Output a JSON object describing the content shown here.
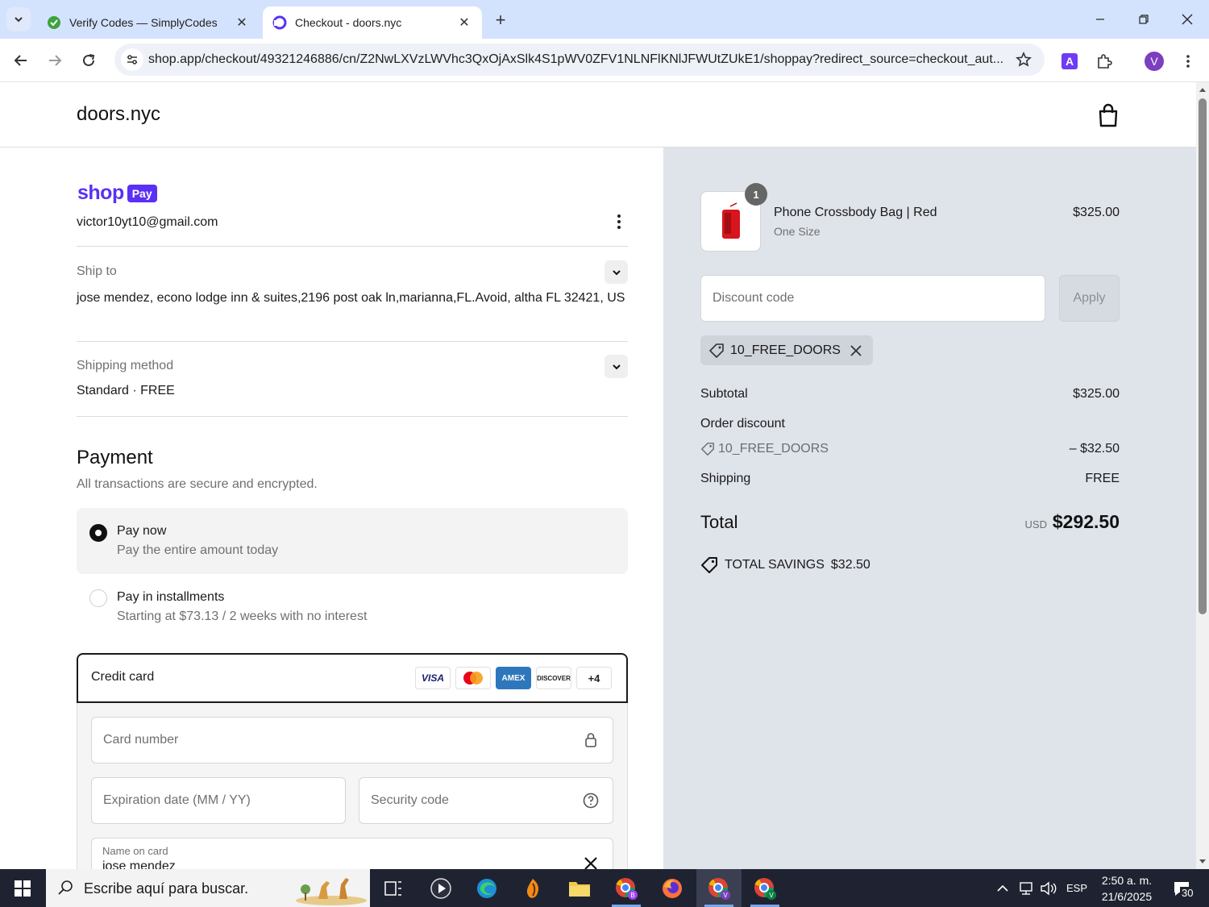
{
  "browser": {
    "tabs": [
      {
        "title": "Verify Codes — SimplyCodes",
        "active": false
      },
      {
        "title": "Checkout - doors.nyc",
        "active": true
      }
    ],
    "url": "shop.app/checkout/49321246886/cn/Z2NwLXVzLWVhc3QxOjAxSlk4S1pWV0ZFV1NLNFlKNlJFWUtZUkE1/shoppay?redirect_source=checkout_aut...",
    "profile_initial": "V"
  },
  "store": {
    "name": "doors.nyc"
  },
  "shop_pay": {
    "logo_word": "shop",
    "logo_badge": "Pay",
    "email": "victor10yt10@gmail.com"
  },
  "ship_to": {
    "label": "Ship to",
    "address": "jose mendez, econo lodge inn & suites,2196 post oak ln,marianna,FL.Avoid, altha FL 32421, US"
  },
  "shipping_method": {
    "label": "Shipping method",
    "value": "Standard · FREE"
  },
  "payment": {
    "title": "Payment",
    "subtitle": "All transactions are secure and encrypted.",
    "options": [
      {
        "title": "Pay now",
        "subtitle": "Pay the entire amount today",
        "selected": true
      },
      {
        "title": "Pay in installments",
        "subtitle": "Starting at $73.13 / 2 weeks with no interest",
        "selected": false
      }
    ],
    "credit_card": {
      "label": "Credit card",
      "brands": [
        "VISA",
        "Mastercard",
        "AMEX",
        "DISCOVER"
      ],
      "more_brands": "+4",
      "card_number_placeholder": "Card number",
      "expiration_placeholder": "Expiration date (MM / YY)",
      "security_placeholder": "Security code",
      "name_label": "Name on card",
      "name_value": "jose mendez"
    }
  },
  "order": {
    "item": {
      "quantity": "1",
      "name": "Phone Crossbody Bag | Red",
      "variant": "One Size",
      "price": "$325.00"
    },
    "discount_placeholder": "Discount code",
    "apply_label": "Apply",
    "applied_code": "10_FREE_DOORS",
    "subtotal_label": "Subtotal",
    "subtotal_value": "$325.00",
    "order_discount_label": "Order discount",
    "discount_code": "10_FREE_DOORS",
    "discount_value": "– $32.50",
    "shipping_label": "Shipping",
    "shipping_value": "FREE",
    "total_label": "Total",
    "total_currency": "USD",
    "total_value": "$292.50",
    "savings_label": "TOTAL SAVINGS",
    "savings_value": "$32.50"
  },
  "taskbar": {
    "search_placeholder": "Escribe aquí para buscar.",
    "language": "ESP",
    "time": "2:50 a. m.",
    "date": "21/6/2025",
    "notifications": "30"
  }
}
